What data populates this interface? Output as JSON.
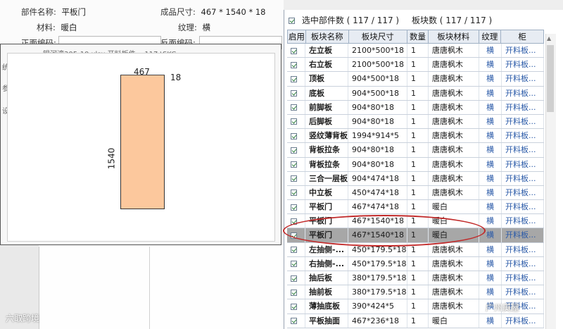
{
  "part_info": {
    "name_label": "部件名称:",
    "name_value": "平板门",
    "size_label": "成品尺寸:",
    "size_value": "467 * 1540 * 18",
    "material_label": "材料:",
    "material_value": "暖白",
    "texture_label": "纹理:",
    "texture_value": "横",
    "front_code_label": "正面编码:",
    "back_code_label": "反面编码:"
  },
  "preview": {
    "ghost_row": "银河湾305-10.xlsx      开料板件...    117     \\SKC",
    "side_labels": [
      "统",
      "参",
      "设"
    ],
    "width_label": "467",
    "thickness_label": "18",
    "height_label": "1540",
    "panel_color": "#fcc89d"
  },
  "table": {
    "selected_count_text": "选中部件数 ( 117 / 117 )",
    "board_count_text": "板块数 ( 117 / 117 )",
    "columns": [
      "启用",
      "板块名称",
      "板块尺寸",
      "数量",
      "板块材料",
      "纹理",
      "柜"
    ],
    "rows": [
      {
        "name": "左立板",
        "size": "2100*500*18",
        "qty": "1",
        "material": "唐唐枫木",
        "texture": "横",
        "cabinet": "开料板..."
      },
      {
        "name": "右立板",
        "size": "2100*500*18",
        "qty": "1",
        "material": "唐唐枫木",
        "texture": "横",
        "cabinet": "开料板..."
      },
      {
        "name": "顶板",
        "size": "904*500*18",
        "qty": "1",
        "material": "唐唐枫木",
        "texture": "横",
        "cabinet": "开料板..."
      },
      {
        "name": "底板",
        "size": "904*500*18",
        "qty": "1",
        "material": "唐唐枫木",
        "texture": "横",
        "cabinet": "开料板..."
      },
      {
        "name": "前脚板",
        "size": "904*80*18",
        "qty": "1",
        "material": "唐唐枫木",
        "texture": "横",
        "cabinet": "开料板..."
      },
      {
        "name": "后脚板",
        "size": "904*80*18",
        "qty": "1",
        "material": "唐唐枫木",
        "texture": "横",
        "cabinet": "开料板..."
      },
      {
        "name": "竖纹薄背板",
        "size": "1994*914*5",
        "qty": "1",
        "material": "唐唐枫木",
        "texture": "横",
        "cabinet": "开料板..."
      },
      {
        "name": "背板拉条",
        "size": "904*80*18",
        "qty": "1",
        "material": "唐唐枫木",
        "texture": "横",
        "cabinet": "开料板..."
      },
      {
        "name": "背板拉条",
        "size": "904*80*18",
        "qty": "1",
        "material": "唐唐枫木",
        "texture": "横",
        "cabinet": "开料板..."
      },
      {
        "name": "三合一层板",
        "size": "904*474*18",
        "qty": "1",
        "material": "唐唐枫木",
        "texture": "横",
        "cabinet": "开料板..."
      },
      {
        "name": "中立板",
        "size": "450*474*18",
        "qty": "1",
        "material": "唐唐枫木",
        "texture": "横",
        "cabinet": "开料板..."
      },
      {
        "name": "平板门",
        "size": "467*474*18",
        "qty": "1",
        "material": "暖白",
        "texture": "横",
        "cabinet": "开料板..."
      },
      {
        "name": "平板门",
        "size": "467*1540*18",
        "qty": "1",
        "material": "暖白",
        "texture": "横",
        "cabinet": "开料板..."
      },
      {
        "name": "平板门",
        "size": "467*1540*18",
        "qty": "1",
        "material": "暖白",
        "texture": "横",
        "cabinet": "开料板...",
        "selected": true
      },
      {
        "name": "左抽侧-...",
        "size": "450*179.5*18",
        "qty": "1",
        "material": "唐唐枫木",
        "texture": "横",
        "cabinet": "开料板..."
      },
      {
        "name": "右抽侧-...",
        "size": "450*179.5*18",
        "qty": "1",
        "material": "唐唐枫木",
        "texture": "横",
        "cabinet": "开料板..."
      },
      {
        "name": "抽后板",
        "size": "380*179.5*18",
        "qty": "1",
        "material": "唐唐枫木",
        "texture": "横",
        "cabinet": "开料板..."
      },
      {
        "name": "抽前板",
        "size": "380*179.5*18",
        "qty": "1",
        "material": "唐唐枫木",
        "texture": "横",
        "cabinet": "开料板..."
      },
      {
        "name": "薄抽底板",
        "size": "390*424*5",
        "qty": "1",
        "material": "唐唐枫木",
        "texture": "横",
        "cabinet": "开料板..."
      },
      {
        "name": "平板抽面",
        "size": "467*236*18",
        "qty": "1",
        "material": "暖白",
        "texture": "横",
        "cabinet": "开料板..."
      }
    ]
  },
  "watermarks": {
    "left": "六取跨境",
    "right": "广州美屋"
  },
  "colors": {
    "annotation": "#c12a2a",
    "selected_row": "#a7a7a7",
    "link_blue": "#2a5aa8"
  }
}
